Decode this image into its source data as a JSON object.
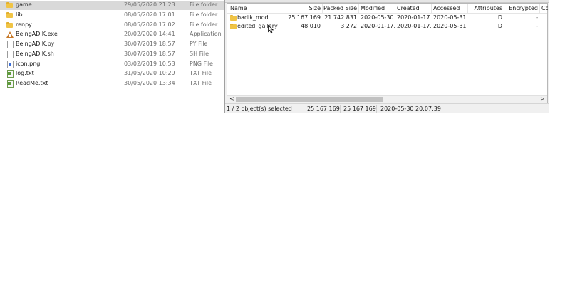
{
  "explorer": {
    "files": [
      {
        "name": "game",
        "date": "29/05/2020 21:23",
        "type": "File folder",
        "icon": "folder-icon",
        "selected": true
      },
      {
        "name": "lib",
        "date": "08/05/2020 17:01",
        "type": "File folder",
        "icon": "folder-icon"
      },
      {
        "name": "renpy",
        "date": "08/05/2020 17:02",
        "type": "File folder",
        "icon": "folder-icon"
      },
      {
        "name": "BeingADIK.exe",
        "date": "20/02/2020 14:41",
        "type": "Application",
        "icon": "application-icon"
      },
      {
        "name": "BeingADIK.py",
        "date": "30/07/2019 18:57",
        "type": "PY File",
        "icon": "document-icon"
      },
      {
        "name": "BeingADIK.sh",
        "date": "30/07/2019 18:57",
        "type": "SH File",
        "icon": "document-icon"
      },
      {
        "name": "icon.png",
        "date": "03/02/2019 10:53",
        "type": "PNG File",
        "icon": "image-icon"
      },
      {
        "name": "log.txt",
        "date": "31/05/2020 10:29",
        "type": "TXT File",
        "icon": "text-file-icon"
      },
      {
        "name": "ReadMe.txt",
        "date": "30/05/2020 13:34",
        "type": "TXT File",
        "icon": "text-file-icon"
      }
    ]
  },
  "archive": {
    "columns": [
      "Name",
      "Size",
      "Packed Size",
      "Modified",
      "Created",
      "Accessed",
      "Attributes",
      "Encrypted",
      "Co"
    ],
    "rows": [
      {
        "name": "badik_mod",
        "size": "25 167 169",
        "packed": "21 742 831",
        "modified": "2020-05-30...",
        "created": "2020-01-17...",
        "accessed": "2020-05-31...",
        "attributes": "D",
        "encrypted": "-"
      },
      {
        "name": "edited_gallery",
        "size": "48 010",
        "packed": "3 272",
        "modified": "2020-01-17...",
        "created": "2020-01-17...",
        "accessed": "2020-05-31...",
        "attributes": "D",
        "encrypted": "-"
      }
    ],
    "status": {
      "selection": "1 / 2 object(s) selected",
      "size": "25 167 169",
      "packed": "25 167 169",
      "modified": "2020-05-30 20:07:39"
    },
    "scroll_left_glyph": "<",
    "scroll_right_glyph": ">"
  }
}
